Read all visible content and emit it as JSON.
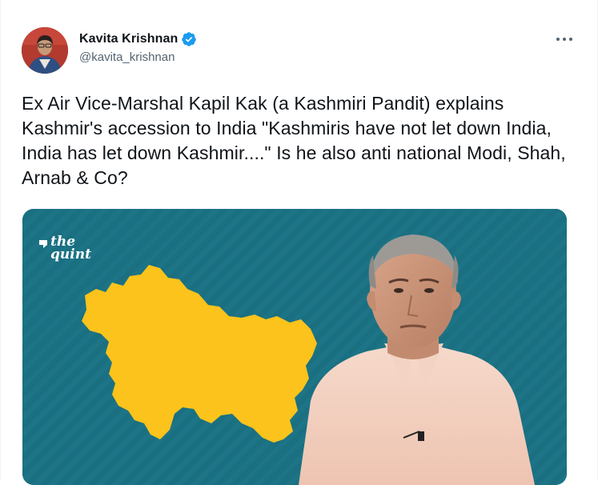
{
  "tweet": {
    "author": {
      "display_name": "Kavita Krishnan",
      "handle": "@kavita_krishnan",
      "verified": true,
      "avatar_icon": "profile-photo"
    },
    "more_icon": "more-horizontal-icon",
    "text": "Ex Air Vice-Marshal Kapil Kak (a Kashmiri Pandit) explains Kashmir's accession to India \"Kashmiris have not let down India, India has let down Kashmir....\" Is he also anti national Modi, Shah, Arnab & Co?",
    "media": {
      "watermark_line1": "the",
      "watermark_line2": "quint",
      "background_color": "#1a6f80",
      "map_color": "#fbc31b"
    }
  },
  "colors": {
    "verified_badge": "#1d9bf0",
    "text_primary": "#0f1419",
    "text_secondary": "#536471"
  }
}
